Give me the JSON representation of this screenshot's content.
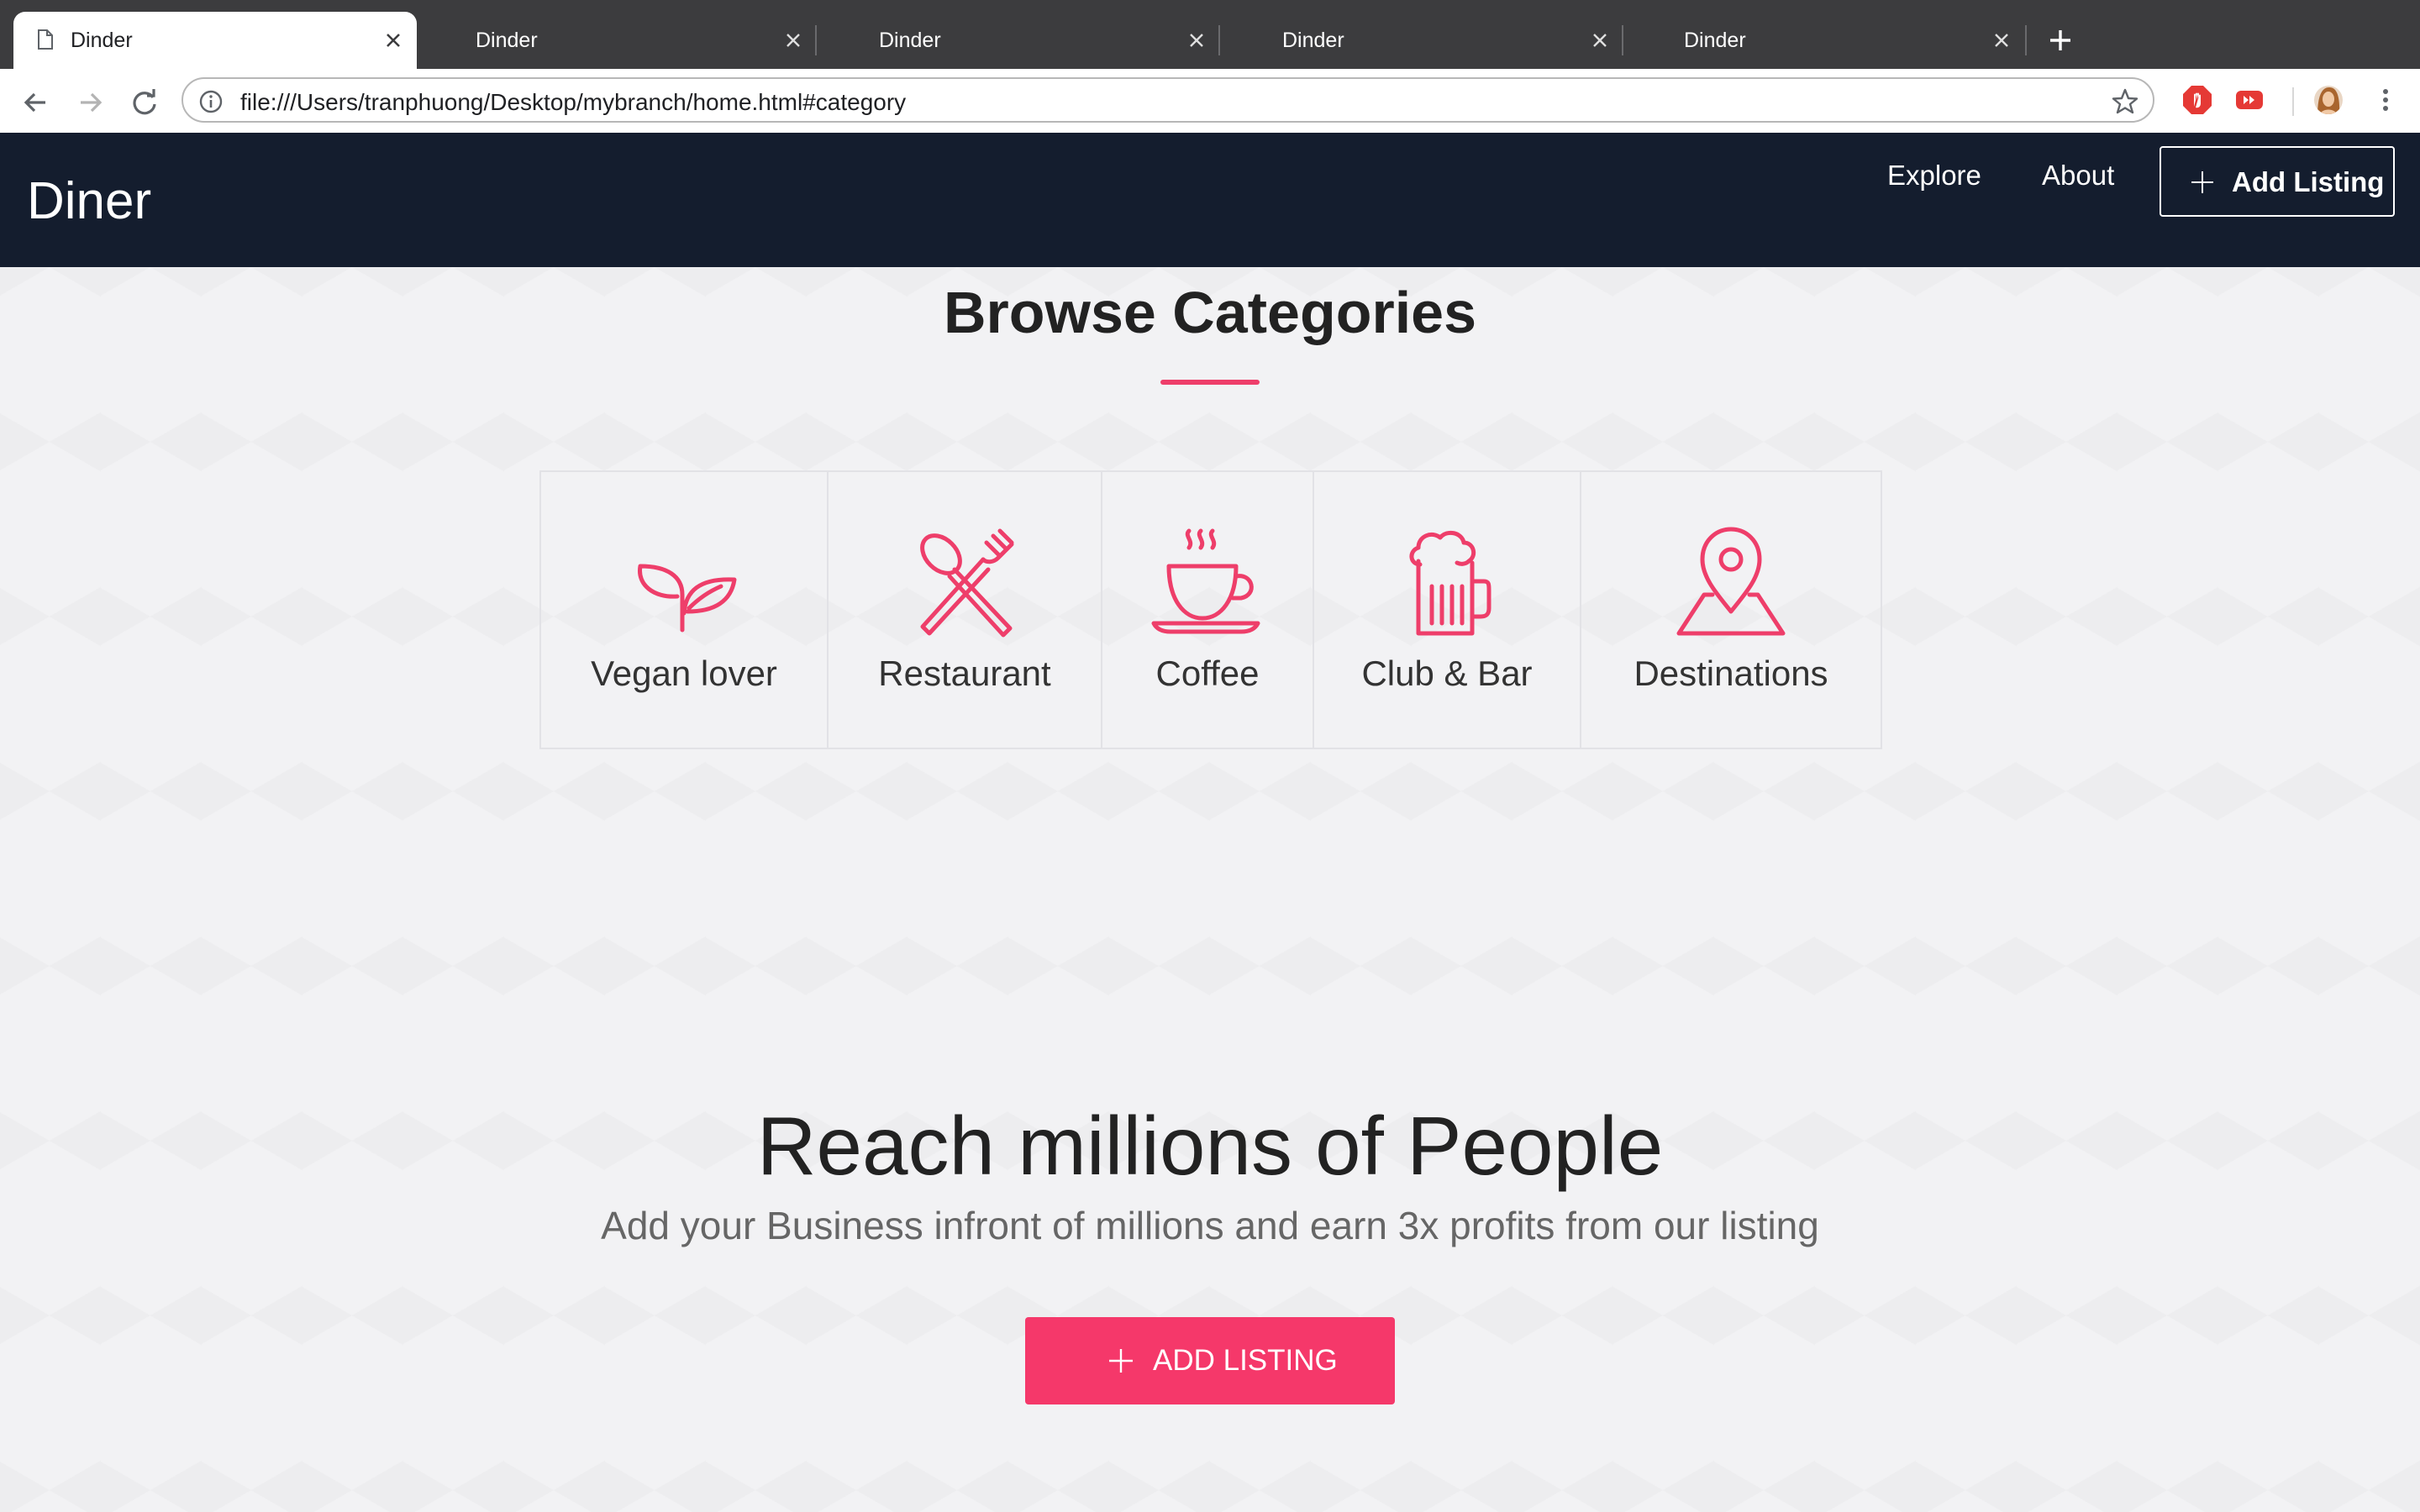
{
  "browser": {
    "tabs": [
      {
        "title": "Dinder",
        "active": true
      },
      {
        "title": "Dinder",
        "active": false
      },
      {
        "title": "Dinder",
        "active": false
      },
      {
        "title": "Dinder",
        "active": false
      },
      {
        "title": "Dinder",
        "active": false
      }
    ],
    "url": "file:///Users/tranphuong/Desktop/mybranch/home.html#category",
    "icons": [
      "back-icon",
      "forward-icon",
      "reload-icon",
      "info-icon",
      "star-icon",
      "new-tab-icon",
      "menu-icon"
    ]
  },
  "header": {
    "logo": "Diner",
    "nav": [
      {
        "label": "Explore"
      },
      {
        "label": "About"
      }
    ],
    "add_listing_label": "Add Listing"
  },
  "categories_section": {
    "title": "Browse Categories",
    "items": [
      {
        "label": "Vegan lover",
        "icon": "sprout-icon"
      },
      {
        "label": "Restaurant",
        "icon": "utensils-icon"
      },
      {
        "label": "Coffee",
        "icon": "coffee-cup-icon"
      },
      {
        "label": "Club & Bar",
        "icon": "beer-mug-icon"
      },
      {
        "label": "Destinations",
        "icon": "map-pin-icon"
      }
    ]
  },
  "cta_section": {
    "title": "Reach millions of People",
    "subtitle": "Add your Business infront of millions and earn 3x profits from our listing",
    "button_label": "ADD LISTING"
  },
  "colors": {
    "accent": "#f5386a",
    "header_bg": "#141d2e",
    "page_bg": "#f2f2f4"
  }
}
